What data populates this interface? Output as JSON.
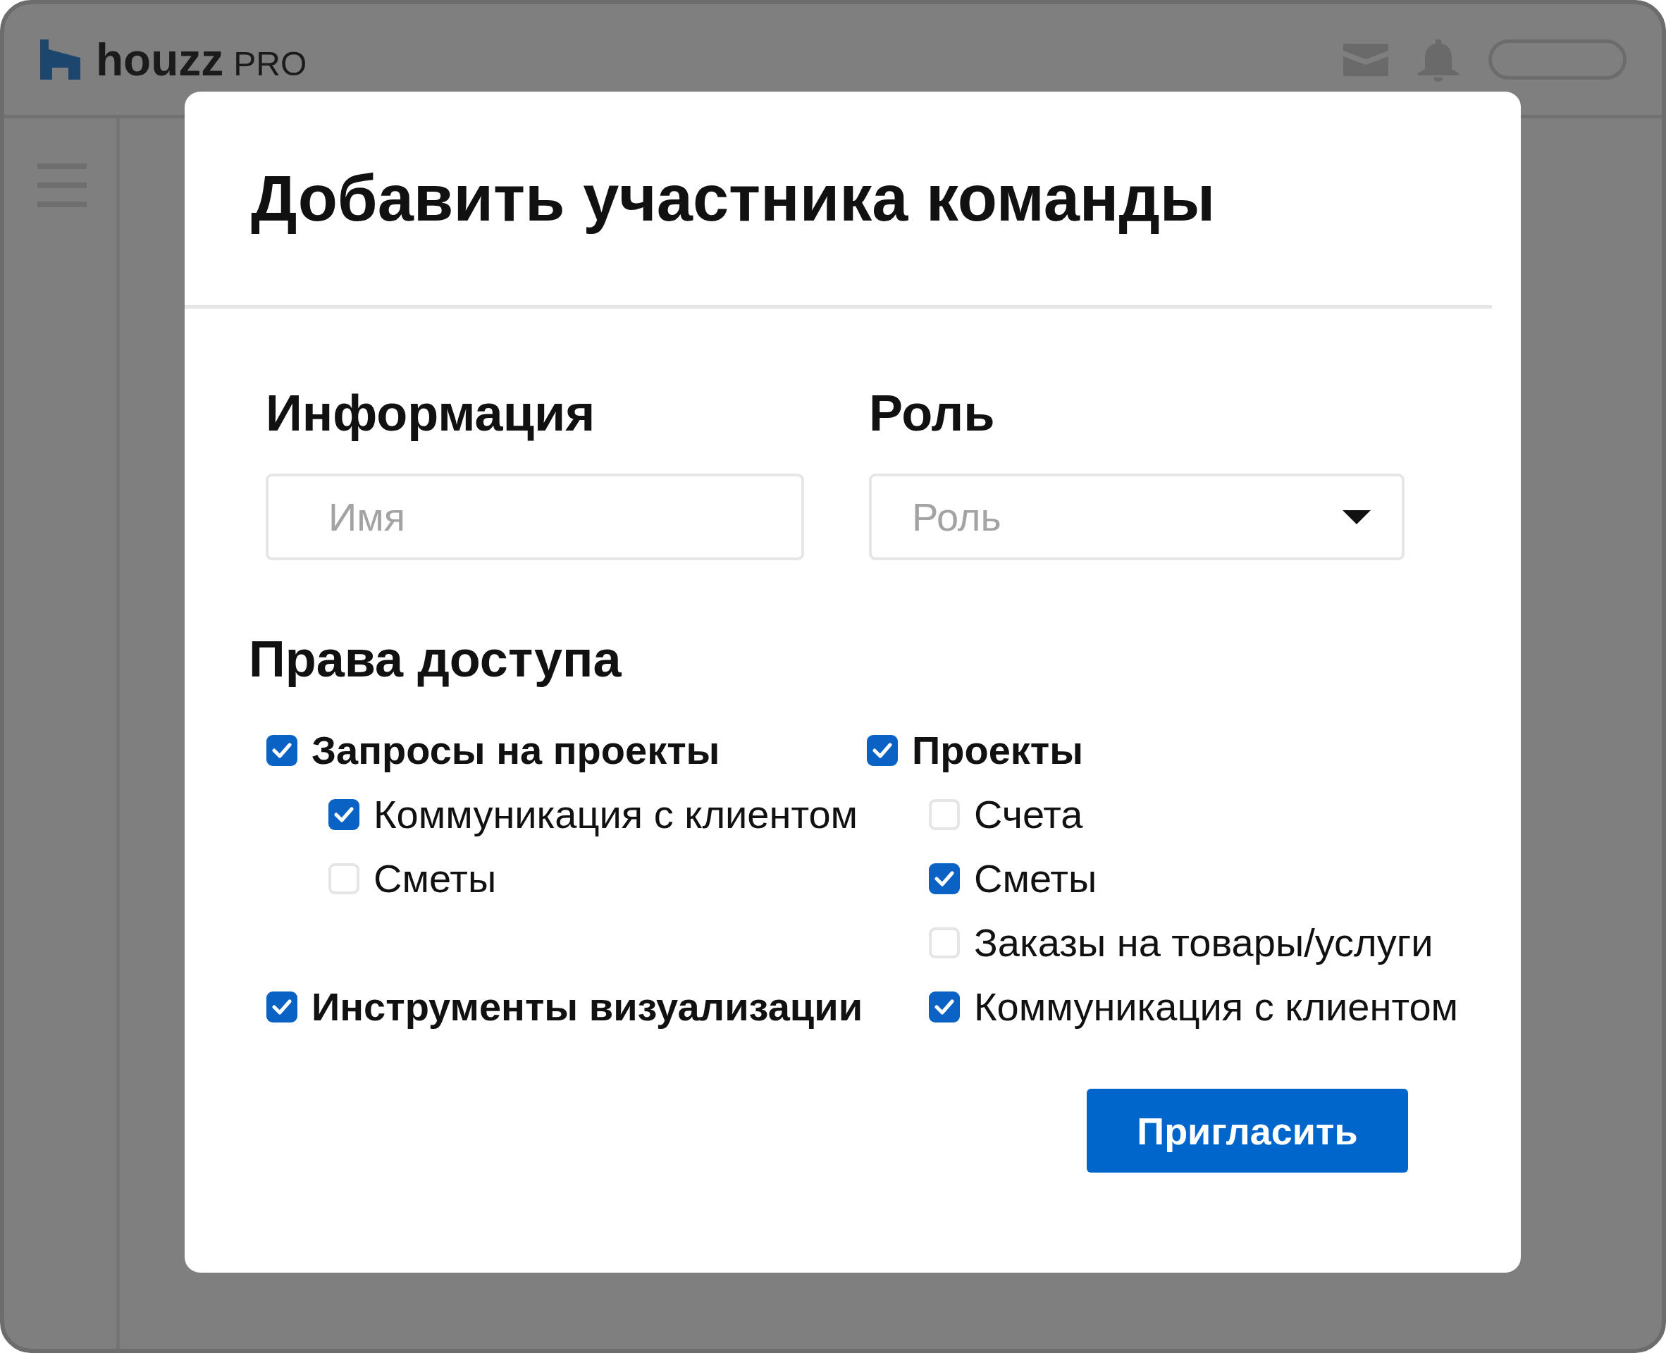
{
  "app": {
    "logo": {
      "name": "houzz",
      "suffix": "PRO"
    }
  },
  "dialog": {
    "title": "Добавить участника команды",
    "info": {
      "heading": "Информация",
      "name_field": {
        "placeholder": "Имя"
      }
    },
    "role": {
      "heading": "Роль",
      "select": {
        "placeholder": "Роль"
      }
    },
    "permissions": {
      "heading": "Права доступа",
      "columns": [
        [
          {
            "label": "Запросы на проекты",
            "checked": true,
            "children": [
              {
                "label": "Коммуникация с клиентом",
                "checked": true
              },
              {
                "label": "Сметы",
                "checked": false
              }
            ]
          },
          {
            "label": "Инструменты визуализации",
            "checked": true
          }
        ],
        [
          {
            "label": "Проекты",
            "checked": true,
            "children": [
              {
                "label": "Счета",
                "checked": false
              },
              {
                "label": "Сметы",
                "checked": true
              },
              {
                "label": "Заказы на товары/услуги",
                "checked": false
              },
              {
                "label": "Коммуникация с клиентом",
                "checked": true
              }
            ]
          }
        ]
      ]
    },
    "invite_button": "Пригласить"
  }
}
